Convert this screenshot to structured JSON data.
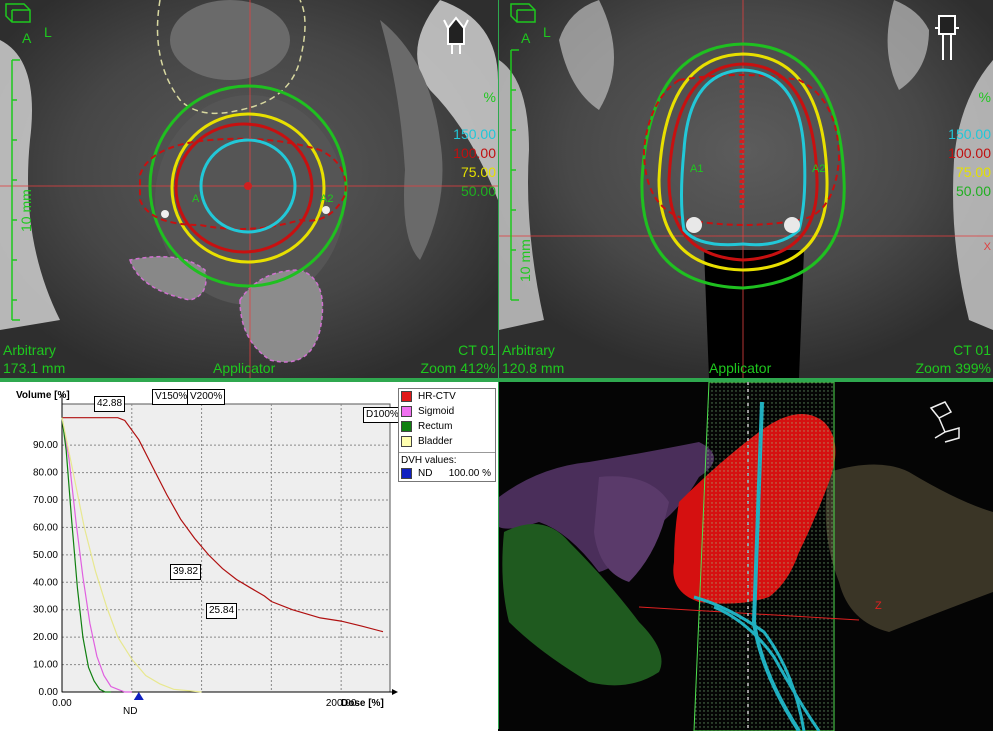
{
  "axial_view": {
    "orientation_a": "A",
    "orientation_l": "L",
    "scale_label": "10 mm",
    "iso_unit": "%",
    "iso_levels": [
      {
        "label": "150.00",
        "color": "#21c7d8"
      },
      {
        "label": "100.00",
        "color": "#c01010"
      },
      {
        "label": "75.00",
        "color": "#e4e000"
      },
      {
        "label": "50.00",
        "color": "#1fb020"
      }
    ],
    "bottom_left_line1": "Arbitrary",
    "bottom_left_line2": "173.1 mm",
    "bottom_center": "Applicator",
    "bottom_right_line1": "CT 01",
    "bottom_right_line2": "Zoom 412%",
    "marker_a1": "A",
    "marker_a2": "A2"
  },
  "coronal_view": {
    "orientation_a": "A",
    "orientation_l": "L",
    "scale_label": "10 mm",
    "iso_unit": "%",
    "iso_levels": [
      {
        "label": "150.00",
        "color": "#21c7d8"
      },
      {
        "label": "100.00",
        "color": "#c01010"
      },
      {
        "label": "75.00",
        "color": "#e4e000"
      },
      {
        "label": "50.00",
        "color": "#1fb020"
      }
    ],
    "bottom_left_line1": "Arbitrary",
    "bottom_left_line2": "120.8 mm",
    "bottom_center": "Applicator",
    "bottom_right_line1": "CT 01",
    "bottom_right_line2": "Zoom 399%",
    "marker_a1": "A1",
    "marker_a2": "A2",
    "edge_marker": "X"
  },
  "view_3d": {
    "axis_label": "Z"
  },
  "dvh": {
    "legend": [
      {
        "label": "HR-CTV",
        "color": "#e01818"
      },
      {
        "label": "Sigmoid",
        "color": "#f070f0"
      },
      {
        "label": "Rectum",
        "color": "#108010"
      },
      {
        "label": "Bladder",
        "color": "#ffffb0"
      }
    ],
    "dvh_values_title": "DVH values:",
    "dvh_values": [
      {
        "label": "ND",
        "value": "100.00 %",
        "color": "#1020c0"
      }
    ],
    "annotations": {
      "v150": "V150%",
      "v200": "V200%",
      "d100": "D100%",
      "nd": "ND"
    }
  },
  "chart_data": {
    "type": "line",
    "xlabel": "Dose [%]",
    "ylabel": "Volume [%]",
    "xlim": [
      0,
      235
    ],
    "ylim": [
      0,
      105
    ],
    "x_ticks": [
      "0.00",
      "200.00"
    ],
    "y_ticks": [
      "0.00",
      "10.00",
      "20.00",
      "30.00",
      "40.00",
      "50.00",
      "60.00",
      "70.00",
      "80.00",
      "90.00"
    ],
    "grid": true,
    "legend_position": "outside-right",
    "series": [
      {
        "name": "HR-CTV",
        "color": "#b01010",
        "x": [
          0,
          25,
          40,
          45,
          55,
          65,
          75,
          85,
          95,
          105,
          115,
          125,
          135,
          145,
          150,
          165,
          175,
          185,
          200,
          215,
          230
        ],
        "y": [
          100,
          100,
          100,
          99,
          92,
          82,
          72,
          63,
          56,
          50,
          45,
          41,
          38,
          35,
          33,
          30,
          28.5,
          27,
          25.84,
          24,
          22
        ]
      },
      {
        "name": "Sigmoid",
        "color": "#e060e0",
        "x": [
          0,
          5,
          10,
          15,
          20,
          25,
          30,
          35,
          40,
          45,
          50
        ],
        "y": [
          100,
          85,
          62,
          42,
          25,
          13,
          6,
          2,
          1,
          0,
          0
        ]
      },
      {
        "name": "Rectum",
        "color": "#108010",
        "x": [
          0,
          3,
          7,
          11,
          15,
          19,
          23,
          27,
          31,
          35
        ],
        "y": [
          100,
          88,
          62,
          38,
          20,
          9,
          4,
          1,
          0,
          0
        ]
      },
      {
        "name": "Bladder",
        "color": "#e8e890",
        "x": [
          0,
          8,
          16,
          24,
          32,
          40,
          50,
          60,
          70,
          80,
          90,
          100
        ],
        "y": [
          100,
          80,
          60,
          44,
          31,
          20,
          12,
          6,
          3,
          1,
          0.5,
          0
        ]
      }
    ],
    "labels": [
      {
        "text": "42.88",
        "x": 30,
        "y": 104
      },
      {
        "text": "39.82",
        "x": 107,
        "y": 44
      },
      {
        "text": "25.84",
        "x": 142,
        "y": 30
      }
    ],
    "nd_marker_x": 55
  }
}
